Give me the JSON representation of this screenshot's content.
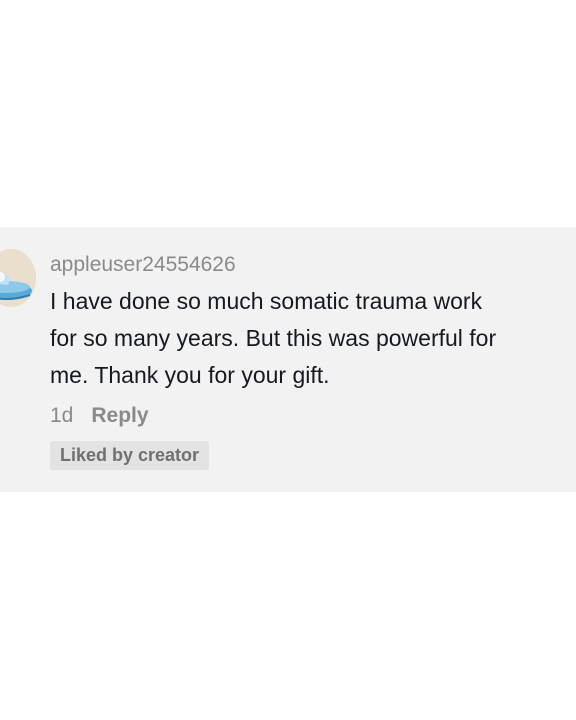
{
  "comment": {
    "username": "appleuser24554626",
    "text_lines": [
      "I have done so much somatic trauma work",
      "for so many years. But this was powerful for",
      "me. Thank you for your gift."
    ],
    "timestamp": "1d",
    "reply_label": "Reply",
    "liked_badge": "Liked by creator",
    "avatar_icon": "avatar-icon"
  },
  "colors": {
    "card_background": "#f2f2f2",
    "text": "#161823",
    "muted": "#8a8a8a",
    "badge_background": "#e3e3e3"
  }
}
